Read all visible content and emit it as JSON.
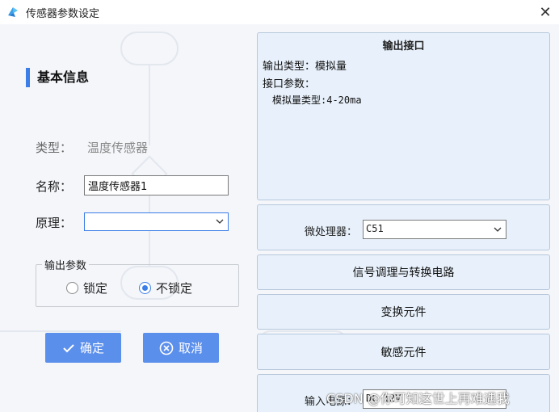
{
  "window": {
    "title": "传感器参数设定"
  },
  "basic": {
    "section_title": "基本信息",
    "type_label": "类型：",
    "type_value": "温度传感器",
    "name_label": "名称：",
    "name_value": "温度传感器1",
    "principle_label": "原理：",
    "principle_value": ""
  },
  "output_params": {
    "legend": "输出参数",
    "options": [
      {
        "label": "锁定",
        "checked": false
      },
      {
        "label": "不锁定",
        "checked": true
      }
    ]
  },
  "buttons": {
    "ok": "确定",
    "cancel": "取消"
  },
  "output_interface": {
    "title": "输出接口",
    "type_line": "输出类型：模拟量",
    "param_line": "接口参数：",
    "analog_line": "模拟量类型:4-20ma"
  },
  "mcu": {
    "label": "微处理器：",
    "value": "C51"
  },
  "blocks": {
    "signal": "信号调理与转换电路",
    "convert": "变换元件",
    "sensitive": "敏感元件"
  },
  "power": {
    "label": "输入电源：",
    "value": "DC 12V"
  },
  "watermark": "CSDN @你可知这世上再难遇我",
  "colors": {
    "accent": "#3b7ee8",
    "button": "#5b8fec",
    "panel": "#e8f1fb"
  }
}
